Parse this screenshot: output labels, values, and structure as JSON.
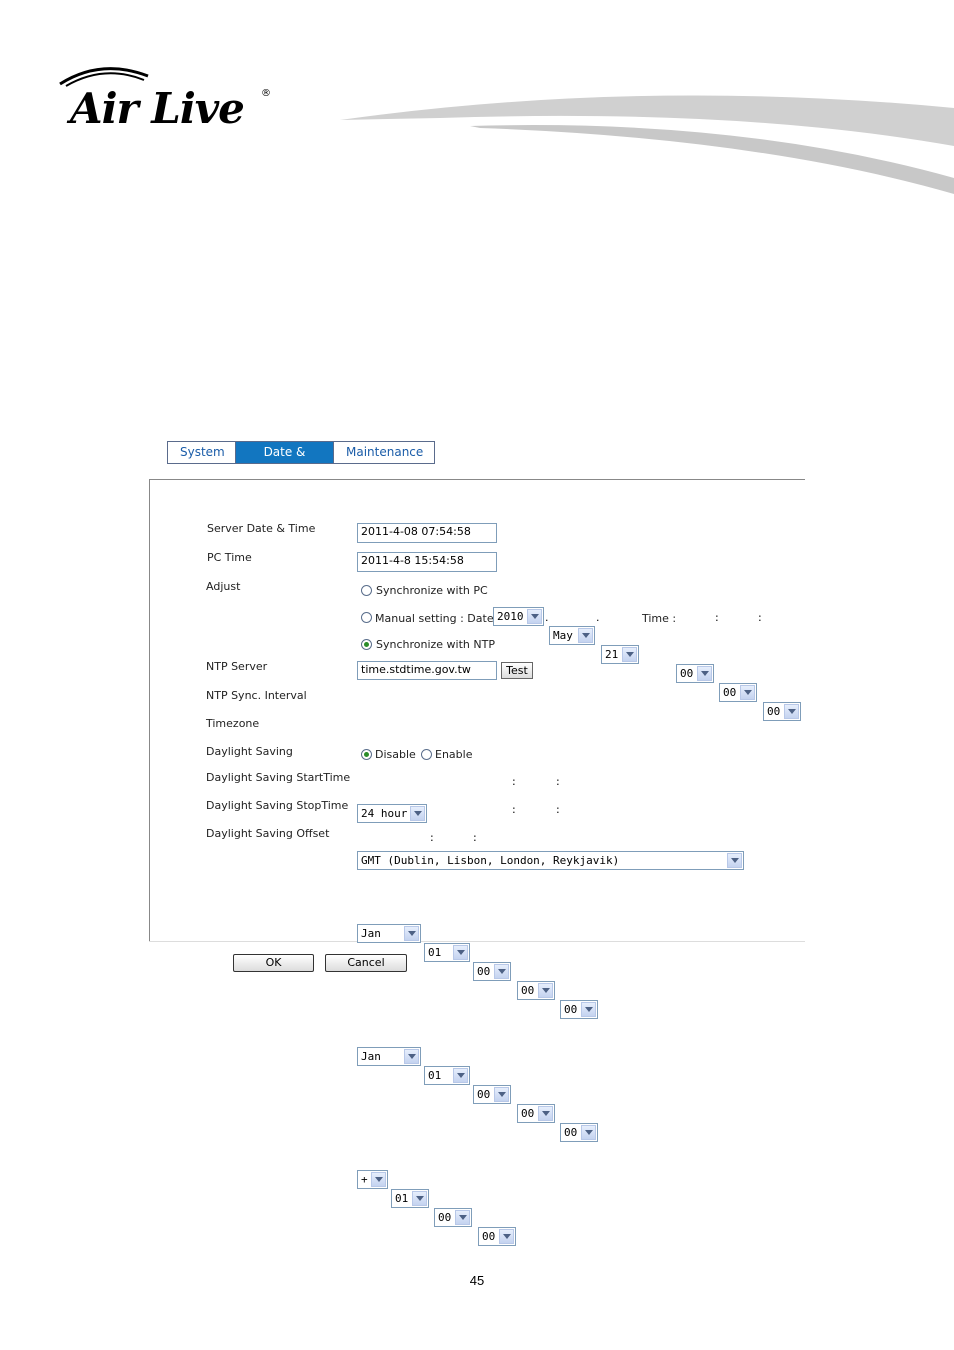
{
  "logo": {
    "text": "Air Live",
    "reg": "®"
  },
  "tabs": [
    {
      "label": "System",
      "active": false
    },
    {
      "label": "Date & Time",
      "active": true
    },
    {
      "label": "Maintenance",
      "active": false
    }
  ],
  "form": {
    "server_datetime": {
      "label": "Server Date & Time",
      "value": "2011-4-08 07:54:58"
    },
    "pc_time": {
      "label": "PC Time",
      "value": "2011-4-8 15:54:58"
    },
    "adjust": {
      "label": "Adjust",
      "sync_pc": "Synchronize with PC",
      "manual": "Manual setting : Date :",
      "time_label": "Time :",
      "sync_ntp": "Synchronize with NTP",
      "selected": "sync_ntp",
      "date_year": "2010",
      "date_month": "May",
      "date_day": "21",
      "time_h": "00",
      "time_m": "00",
      "time_s": "00"
    },
    "ntp_server": {
      "label": "NTP Server",
      "value": "time.stdtime.gov.tw",
      "test_label": "Test"
    },
    "ntp_interval": {
      "label": "NTP Sync. Interval",
      "value": "24 hour"
    },
    "timezone": {
      "label": "Timezone",
      "value": "GMT (Dublin, Lisbon, London, Reykjavik)"
    },
    "daylight": {
      "label": "Daylight Saving",
      "disable": "Disable",
      "enable": "Enable",
      "selected": "disable"
    },
    "ds_start": {
      "label": "Daylight Saving StartTime",
      "month": "Jan",
      "day": "01",
      "h": "00",
      "m": "00",
      "s": "00"
    },
    "ds_stop": {
      "label": "Daylight Saving StopTime",
      "month": "Jan",
      "day": "01",
      "h": "00",
      "m": "00",
      "s": "00"
    },
    "ds_offset": {
      "label": "Daylight Saving Offset",
      "sign": "+",
      "h": "01",
      "m": "00",
      "s": "00"
    }
  },
  "buttons": {
    "ok": "OK",
    "cancel": "Cancel"
  },
  "page_number": "45",
  "sep_dot": ".",
  "sep_colon": ":"
}
